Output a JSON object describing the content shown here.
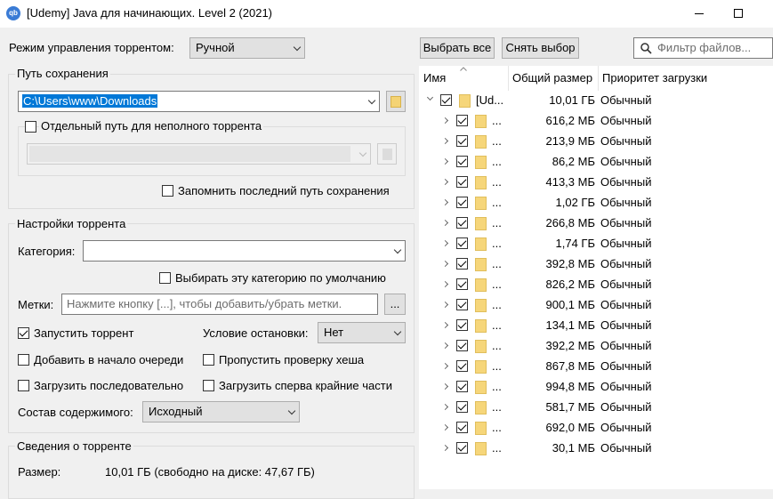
{
  "window": {
    "title": "[Udemy] Java для начинающих. Level 2 (2021)",
    "app_icon": "qb"
  },
  "torrent_mode": {
    "label": "Режим управления торрентом:",
    "value": "Ручной"
  },
  "save_path": {
    "group_title": "Путь сохранения",
    "path": "C:\\Users\\www\\Downloads",
    "incomplete_checkbox_label": "Отдельный путь для неполного торрента",
    "incomplete_checked": false,
    "remember_label": "Запомнить последний путь сохранения",
    "remember_checked": false
  },
  "torrent_settings": {
    "group_title": "Настройки торрента",
    "category_label": "Категория:",
    "category_value": "",
    "default_category_label": "Выбирать эту категорию по умолчанию",
    "default_category_checked": false,
    "tags_label": "Метки:",
    "tags_placeholder": "Нажмите кнопку [...], чтобы добавить/убрать метки.",
    "tags_button": "...",
    "start_torrent_label": "Запустить торрент",
    "start_torrent_checked": true,
    "stop_condition_label": "Условие остановки:",
    "stop_condition_value": "Нет",
    "add_top_queue_label": "Добавить в начало очереди",
    "add_top_queue_checked": false,
    "skip_hash_label": "Пропустить проверку хеша",
    "skip_hash_checked": false,
    "sequential_label": "Загрузить последовательно",
    "sequential_checked": false,
    "first_last_label": "Загрузить сперва крайние части",
    "first_last_checked": false,
    "content_layout_label": "Состав содержимого:",
    "content_layout_value": "Исходный"
  },
  "torrent_info": {
    "group_title": "Сведения о торренте",
    "size_label": "Размер:",
    "size_value": "10,01 ГБ (свободно на диске: 47,67 ГБ)"
  },
  "file_panel": {
    "select_all": "Выбрать все",
    "select_none": "Снять выбор",
    "filter_placeholder": "Фильтр файлов...",
    "columns": [
      "Имя",
      "Общий размер",
      "Приоритет загрузки"
    ],
    "root": {
      "name": "[Ud...",
      "size": "10,01 ГБ",
      "priority": "Обычный",
      "checked": true
    },
    "items": [
      {
        "name": "...",
        "size": "616,2 МБ",
        "priority": "Обычный",
        "checked": true
      },
      {
        "name": "...",
        "size": "213,9 МБ",
        "priority": "Обычный",
        "checked": true
      },
      {
        "name": "...",
        "size": "86,2 МБ",
        "priority": "Обычный",
        "checked": true
      },
      {
        "name": "...",
        "size": "413,3 МБ",
        "priority": "Обычный",
        "checked": true
      },
      {
        "name": "...",
        "size": "1,02 ГБ",
        "priority": "Обычный",
        "checked": true
      },
      {
        "name": "...",
        "size": "266,8 МБ",
        "priority": "Обычный",
        "checked": true
      },
      {
        "name": "...",
        "size": "1,74 ГБ",
        "priority": "Обычный",
        "checked": true
      },
      {
        "name": "...",
        "size": "392,8 МБ",
        "priority": "Обычный",
        "checked": true
      },
      {
        "name": "...",
        "size": "826,2 МБ",
        "priority": "Обычный",
        "checked": true
      },
      {
        "name": "...",
        "size": "900,1 МБ",
        "priority": "Обычный",
        "checked": true
      },
      {
        "name": "...",
        "size": "134,1 МБ",
        "priority": "Обычный",
        "checked": true
      },
      {
        "name": "...",
        "size": "392,2 МБ",
        "priority": "Обычный",
        "checked": true
      },
      {
        "name": "...",
        "size": "867,8 МБ",
        "priority": "Обычный",
        "checked": true
      },
      {
        "name": "...",
        "size": "994,8 МБ",
        "priority": "Обычный",
        "checked": true
      },
      {
        "name": "...",
        "size": "581,7 МБ",
        "priority": "Обычный",
        "checked": true
      },
      {
        "name": "...",
        "size": "692,0 МБ",
        "priority": "Обычный",
        "checked": true
      },
      {
        "name": "...",
        "size": "30,1 МБ",
        "priority": "Обычный",
        "checked": true
      }
    ]
  },
  "colors": {
    "accent": "#0078d7",
    "selection": "#0078d7",
    "folder": "#f6d67a"
  }
}
